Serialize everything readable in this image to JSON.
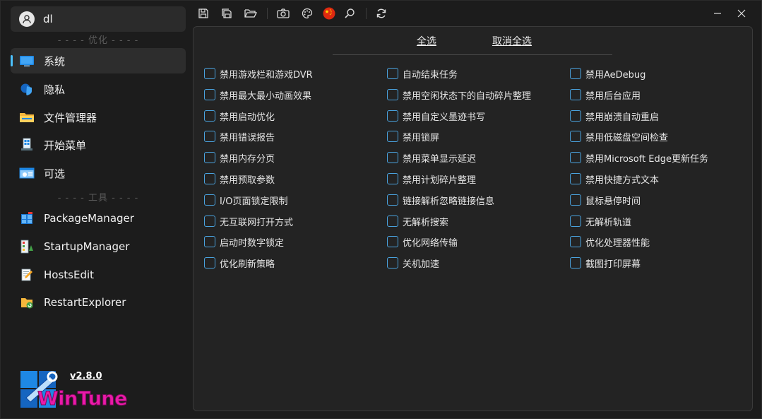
{
  "user": {
    "name": "dl"
  },
  "sidebar": {
    "section_optimize": "- - - - 优化 - - - -",
    "section_tools": "- - - - 工具 - - - -",
    "items": [
      {
        "label": "系统",
        "icon": "monitor-icon"
      },
      {
        "label": "隐私",
        "icon": "shield-icon"
      },
      {
        "label": "文件管理器",
        "icon": "folder-icon"
      },
      {
        "label": "开始菜单",
        "icon": "start-menu-icon"
      },
      {
        "label": "可选",
        "icon": "settings-window-icon"
      }
    ],
    "tools": [
      {
        "label": "PackageManager",
        "icon": "package-icon"
      },
      {
        "label": "StartupManager",
        "icon": "startup-icon"
      },
      {
        "label": "HostsEdit",
        "icon": "hosts-edit-icon"
      },
      {
        "label": "RestartExplorer",
        "icon": "restart-explorer-icon"
      }
    ],
    "version": "v2.8.0",
    "logo_text": "WinTune"
  },
  "toolbar": {
    "icons": [
      "save-icon",
      "save-all-icon",
      "open-folder-icon",
      "camera-icon",
      "palette-icon",
      "china-flag-icon",
      "search-icon",
      "refresh-icon"
    ]
  },
  "panel": {
    "select_all": "全选",
    "deselect_all": "取消全选",
    "columns": [
      [
        "禁用游戏栏和游戏DVR",
        "禁用最大最小动画效果",
        "禁用启动优化",
        "禁用错误报告",
        "禁用内存分页",
        "禁用预取参数",
        "I/O页面锁定限制",
        "无互联网打开方式",
        "启动时数字锁定",
        "优化刷新策略"
      ],
      [
        "自动结束任务",
        "禁用空闲状态下的自动碎片整理",
        "禁用自定义墨迹书写",
        "禁用锁屏",
        "禁用菜单显示延迟",
        "禁用计划碎片整理",
        "链接解析忽略链接信息",
        "无解析搜索",
        "优化网络传输",
        "关机加速"
      ],
      [
        "禁用AeDebug",
        "禁用后台应用",
        "禁用崩溃自动重启",
        "禁用低磁盘空间检查",
        "禁用Microsoft Edge更新任务",
        "禁用快捷方式文本",
        "鼠标悬停时间",
        "无解析轨道",
        "优化处理器性能",
        "截图打印屏幕"
      ]
    ]
  },
  "colors": {
    "accent": "#4cc2ff",
    "checkbox": "#4aa3df",
    "logo": "#ea1aa8"
  }
}
